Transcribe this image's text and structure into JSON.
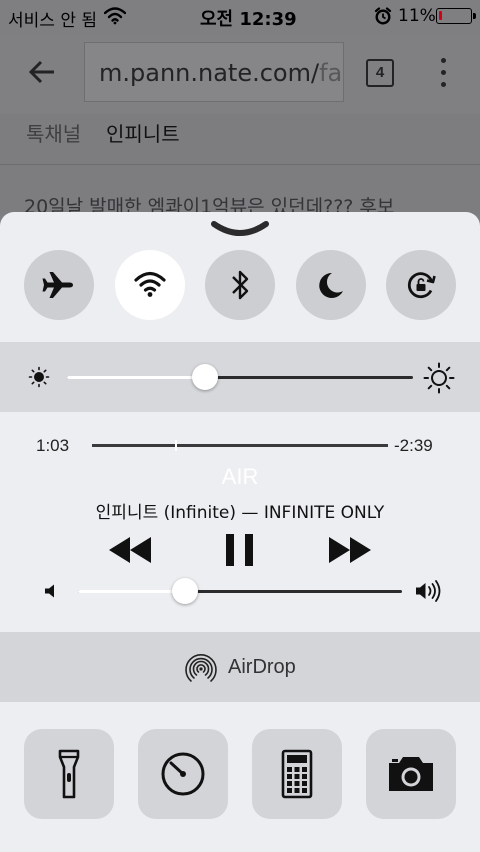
{
  "status_bar": {
    "carrier": "서비스 안 됨",
    "time": "오전 12:39",
    "battery_percent": "11%",
    "battery_level": 0.11,
    "battery_color": "#d0021b"
  },
  "browser": {
    "url_visible": "m.pann.nate.com/",
    "url_faded": "fant",
    "tab_count": "4",
    "channel_label": "톡채널",
    "channel_name": "인피니트",
    "article_preview": "20일날 발매한 엠콰이1억뷰은 있던데??? 후보"
  },
  "control_center": {
    "toggles": [
      {
        "name": "airplane-mode",
        "icon": "airplane-icon",
        "on": false
      },
      {
        "name": "wifi",
        "icon": "wifi-icon",
        "on": true
      },
      {
        "name": "bluetooth",
        "icon": "bluetooth-icon",
        "on": false
      },
      {
        "name": "do-not-disturb",
        "icon": "moon-icon",
        "on": false
      },
      {
        "name": "orientation-lock",
        "icon": "rotation-lock-icon",
        "on": false
      }
    ],
    "brightness_level": 0.4,
    "now_playing": {
      "elapsed": "1:03",
      "remaining": "-2:39",
      "progress": 0.28,
      "title": "AIR",
      "artist_album": "인피니트 (Infinite) — INFINITE ONLY"
    },
    "volume_level": 0.33,
    "airdrop_label": "AirDrop",
    "tools": [
      {
        "name": "flashlight",
        "icon": "flashlight-icon"
      },
      {
        "name": "timer",
        "icon": "timer-icon"
      },
      {
        "name": "calculator",
        "icon": "calculator-icon"
      },
      {
        "name": "camera",
        "icon": "camera-icon"
      }
    ]
  }
}
